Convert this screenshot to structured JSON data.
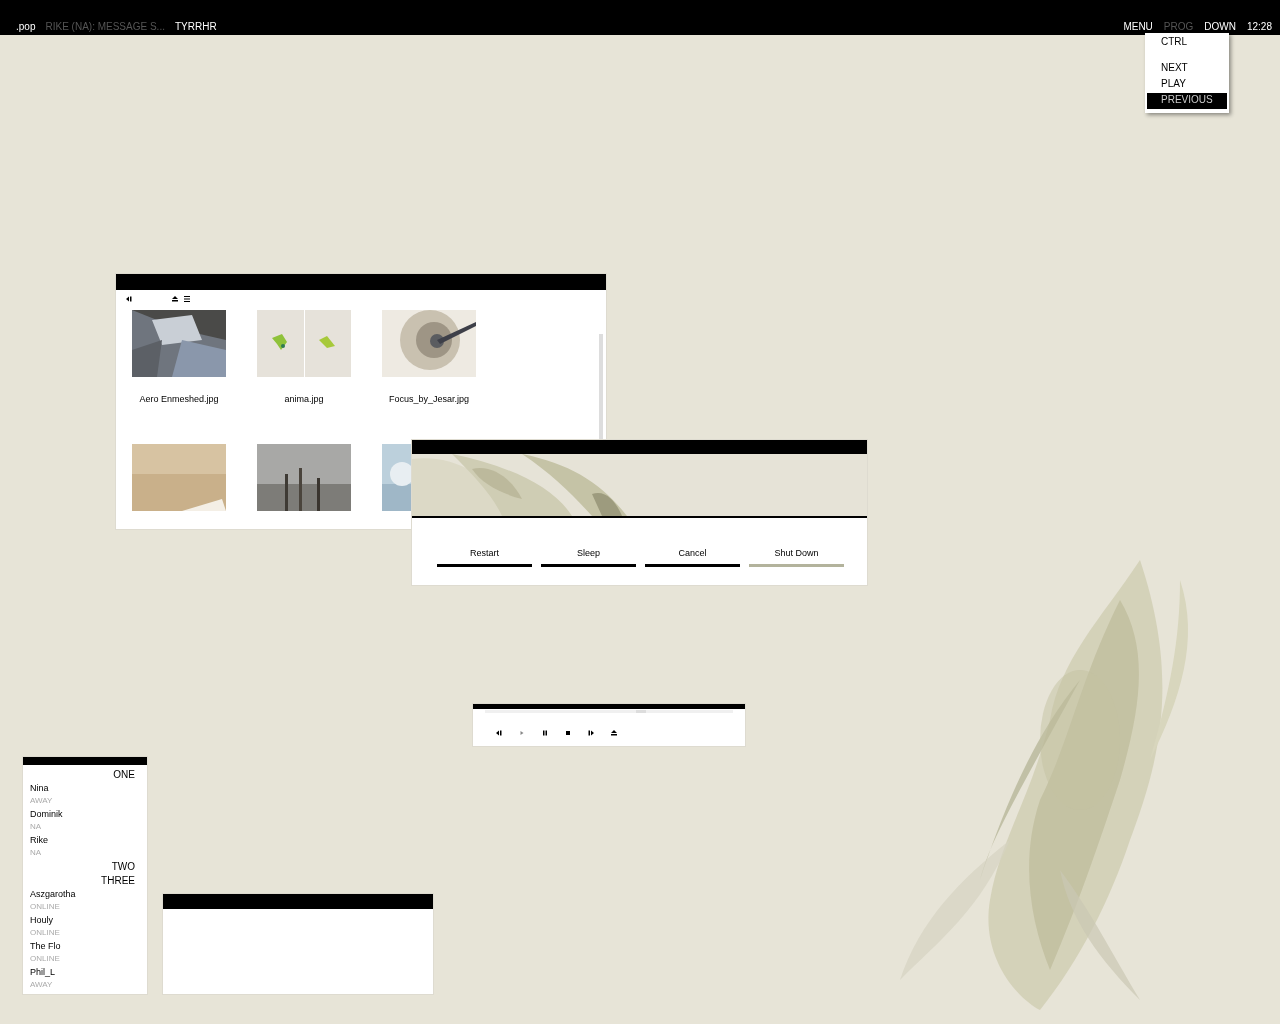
{
  "top_bar": {
    "left": [
      {
        "label": ".pop",
        "dimmed": false
      },
      {
        "label": "RIKE (NA): MESSAGE S...",
        "dimmed": true
      },
      {
        "label": "TYRRHR",
        "dimmed": false
      }
    ],
    "right": [
      {
        "label": "MENU",
        "dimmed": false
      },
      {
        "label": "PROG",
        "dimmed": true
      },
      {
        "label": "DOWN",
        "dimmed": false
      }
    ],
    "clock": "12:28"
  },
  "menu": {
    "sections": [
      {
        "items": [
          {
            "label": "CTRL",
            "selected": false
          }
        ]
      },
      {
        "items": [
          {
            "label": "NEXT",
            "selected": false
          },
          {
            "label": "PLAY",
            "selected": false
          },
          {
            "label": "PREVIOUS",
            "selected": true
          }
        ]
      }
    ]
  },
  "file_window": {
    "files": [
      {
        "name": "Aero Enmeshed.jpg",
        "kind": "picture"
      },
      {
        "name": "anima.jpg",
        "kind": "picture"
      },
      {
        "name": "Focus_by_Jesar.jpg",
        "kind": "picture"
      },
      {
        "kind": "picture"
      },
      {
        "kind": "picture"
      },
      {
        "kind": "picture"
      }
    ]
  },
  "shutdown_dialog": {
    "buttons": [
      {
        "label": "Restart",
        "focused": false
      },
      {
        "label": "Sleep",
        "focused": false
      },
      {
        "label": "Cancel",
        "focused": false
      },
      {
        "label": "Shut Down",
        "focused": true
      }
    ]
  },
  "player": {
    "seek": {
      "level": 0.63
    }
  },
  "buddy_list": {
    "groups": [
      {
        "name": "ONE",
        "contacts": [
          {
            "name": "Nina",
            "status": "AWAY"
          },
          {
            "name": "Dominik",
            "status": "NA"
          },
          {
            "name": "Rike",
            "status": "NA"
          }
        ]
      },
      {
        "name": "TWO"
      },
      {
        "name": "THREE",
        "contacts": [
          {
            "name": "Aszgarotha",
            "status": "ONLINE"
          },
          {
            "name": "Houly",
            "status": "ONLINE"
          },
          {
            "name": "The Flo",
            "status": "ONLINE"
          },
          {
            "name": "Phil_L",
            "status": "AWAY"
          }
        ]
      }
    ]
  }
}
